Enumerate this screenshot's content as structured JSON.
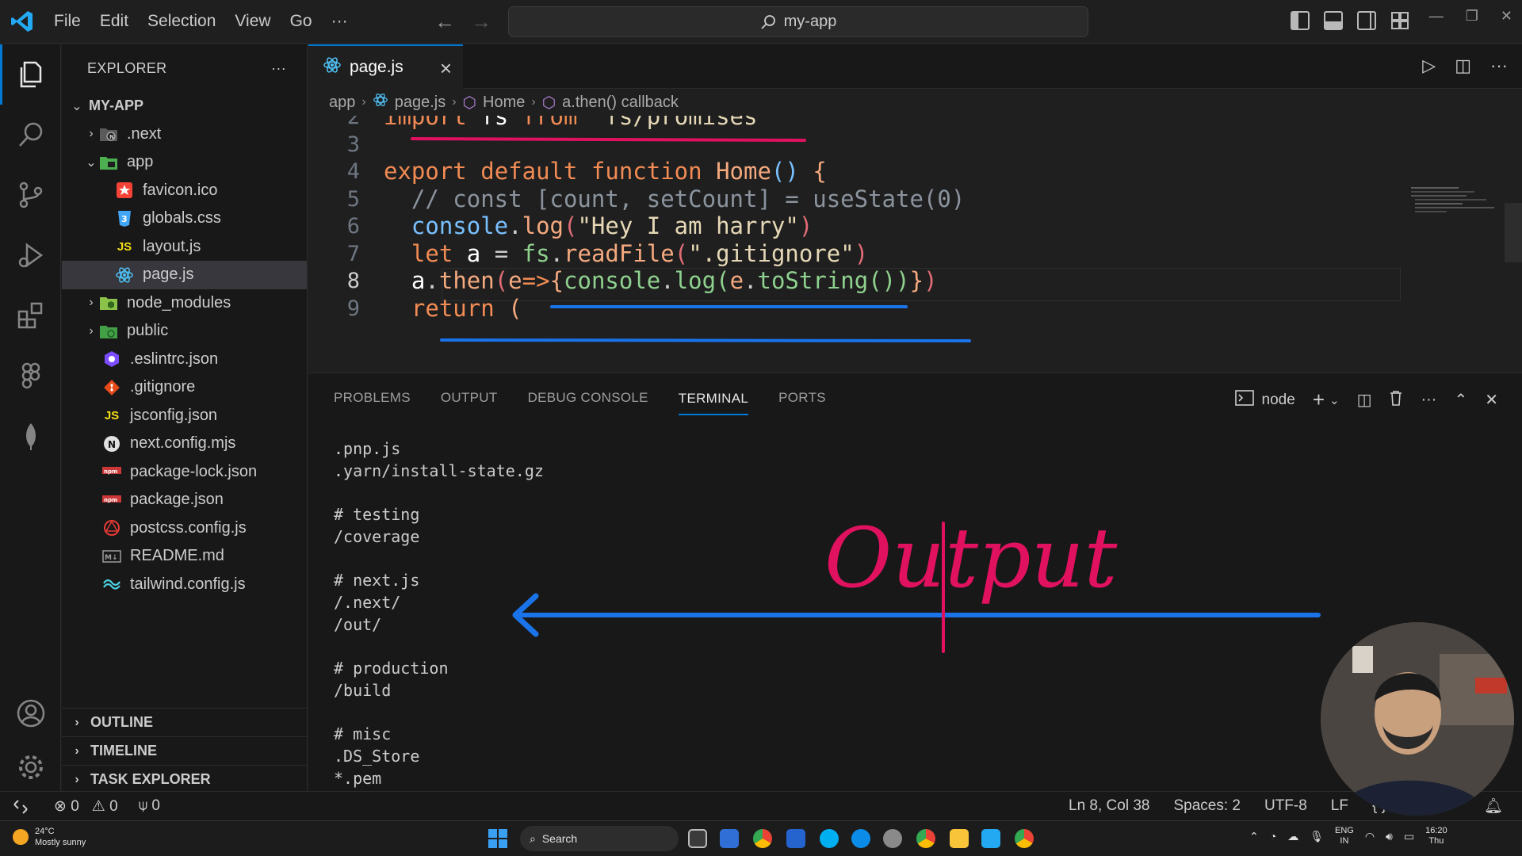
{
  "titlebar": {
    "menu": [
      "File",
      "Edit",
      "Selection",
      "View",
      "Go",
      "···"
    ],
    "command_center": "my-app"
  },
  "sidebar": {
    "title": "EXPLORER",
    "more": "···",
    "root": "MY-APP",
    "items": [
      {
        "label": ".next",
        "icon": "next-folder-icon"
      },
      {
        "label": "app",
        "icon": "app-folder-icon"
      },
      {
        "label": "favicon.ico",
        "icon": "star-icon"
      },
      {
        "label": "globals.css",
        "icon": "css-icon"
      },
      {
        "label": "layout.js",
        "icon": "js-icon"
      },
      {
        "label": "page.js",
        "icon": "react-icon"
      },
      {
        "label": "node_modules",
        "icon": "node-folder-icon"
      },
      {
        "label": "public",
        "icon": "public-folder-icon"
      },
      {
        "label": ".eslintrc.json",
        "icon": "eslint-icon"
      },
      {
        "label": ".gitignore",
        "icon": "git-icon"
      },
      {
        "label": "jsconfig.json",
        "icon": "js-icon"
      },
      {
        "label": "next.config.mjs",
        "icon": "next-icon"
      },
      {
        "label": "package-lock.json",
        "icon": "npm-icon"
      },
      {
        "label": "package.json",
        "icon": "npm-icon"
      },
      {
        "label": "postcss.config.js",
        "icon": "postcss-icon"
      },
      {
        "label": "README.md",
        "icon": "markdown-icon"
      },
      {
        "label": "tailwind.config.js",
        "icon": "tailwind-icon"
      }
    ],
    "sections": [
      "OUTLINE",
      "TIMELINE",
      "TASK EXPLORER"
    ]
  },
  "editor": {
    "tab": "page.js",
    "breadcrumb": [
      "app",
      "page.js",
      "Home",
      "a.then() callback"
    ],
    "lines": [
      {
        "n": "2",
        "text": "import fs from \"fs/promises\""
      },
      {
        "n": "3",
        "text": ""
      },
      {
        "n": "4",
        "text": "export default function Home() {"
      },
      {
        "n": "5",
        "text": "  // const [count, setCount] = useState(0)"
      },
      {
        "n": "6",
        "text": "  console.log(\"Hey I am harry\")"
      },
      {
        "n": "7",
        "text": "  let a = fs.readFile(\".gitignore\")"
      },
      {
        "n": "8",
        "text": "  a.then(e=>{console.log(e.toString())})"
      },
      {
        "n": "9",
        "text": "  return ("
      }
    ],
    "current_line": 8
  },
  "panel": {
    "tabs": [
      "PROBLEMS",
      "OUTPUT",
      "DEBUG CONSOLE",
      "TERMINAL",
      "PORTS"
    ],
    "active_tab": "TERMINAL",
    "terminal_name": "node",
    "terminal_lines": [
      ".pnp.js",
      ".yarn/install-state.gz",
      "",
      "# testing",
      "/coverage",
      "",
      "# next.js",
      "/.next/",
      "/out/",
      "",
      "# production",
      "/build",
      "",
      "# misc",
      ".DS_Store",
      "*.pem"
    ]
  },
  "annotation": {
    "text": "Output",
    "colors": {
      "red": "#e0115f",
      "blue": "#1a73e8"
    }
  },
  "statusbar": {
    "errors": "0",
    "warnings": "0",
    "ports": "0",
    "position": "Ln 8, Col 38",
    "spaces": "Spaces: 2",
    "encoding": "UTF-8",
    "eol": "LF",
    "lang": "{ }"
  },
  "taskbar": {
    "temp": "24°C",
    "weather": "Mostly sunny",
    "search": "Search",
    "lang1": "ENG",
    "lang2": "IN",
    "time": "16:20",
    "day": "Thu"
  },
  "colors": {
    "accent": "#0078d4",
    "bg_editor": "#1f1f1f",
    "bg_sidebar": "#181818"
  }
}
